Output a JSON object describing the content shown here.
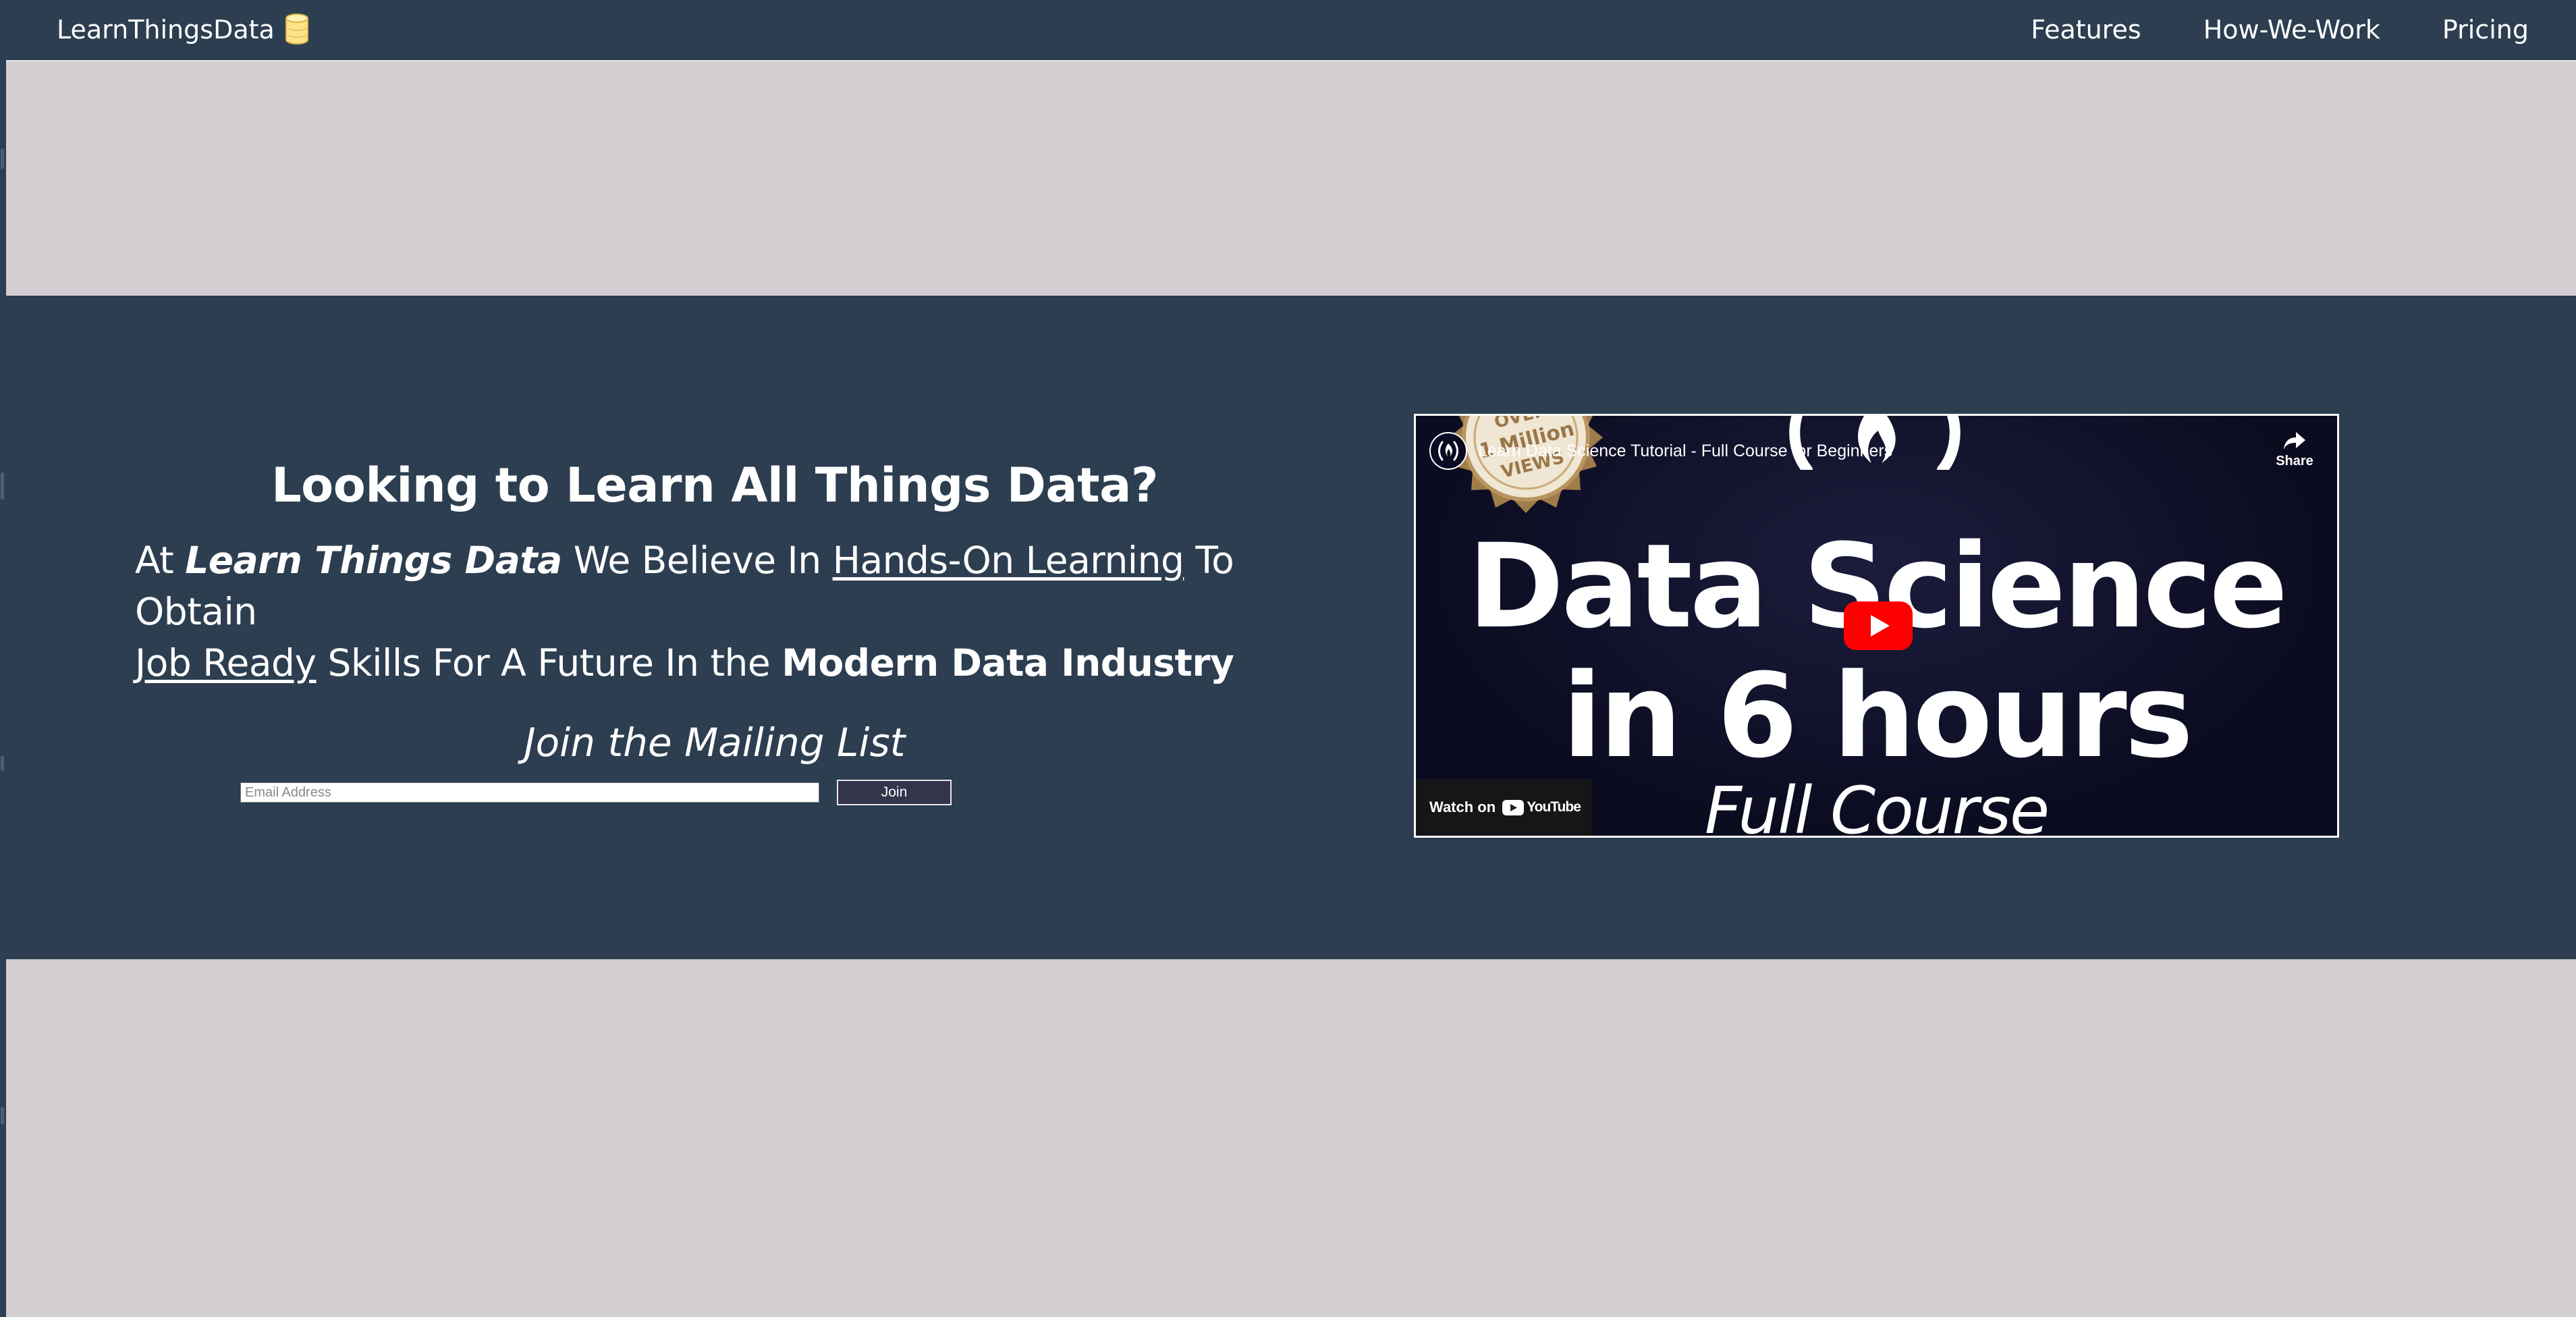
{
  "navbar": {
    "brand": "LearnThingsData",
    "brand_icon": "database-icon",
    "links": [
      {
        "label": "Features"
      },
      {
        "label": "How-We-Work"
      },
      {
        "label": "Pricing"
      }
    ]
  },
  "hero": {
    "title": "Looking to Learn All Things Data?",
    "text": {
      "at": "At ",
      "brand": "Learn Things Data",
      "believe": " We Believe In ",
      "hands_on": "Hands-On Learning",
      "to_obtain": " To Obtain ",
      "job_ready": "Job Ready",
      "skills": " Skills For A Future In the ",
      "industry": "Modern Data Industry"
    },
    "mailing_title": "Join the Mailing List",
    "email_placeholder": "Email Address",
    "join_label": "Join"
  },
  "video": {
    "title": "Learn Data Science Tutorial - Full Course for Beginners",
    "share_label": "Share",
    "thumbnail_line1": "Data Science",
    "thumbnail_line2": "in 6 hours",
    "thumbnail_line3": "Full Course",
    "badge_top": "OVER",
    "badge_mid": "1 Million",
    "badge_bottom": "VIEWS",
    "watch_on": "Watch on",
    "youtube_word": "YouTube"
  },
  "colors": {
    "navbar_bg": "#2c3e50",
    "page_bg": "#d3ced2",
    "hero_bg": "#2c3e50",
    "play_red": "#ff0000"
  }
}
